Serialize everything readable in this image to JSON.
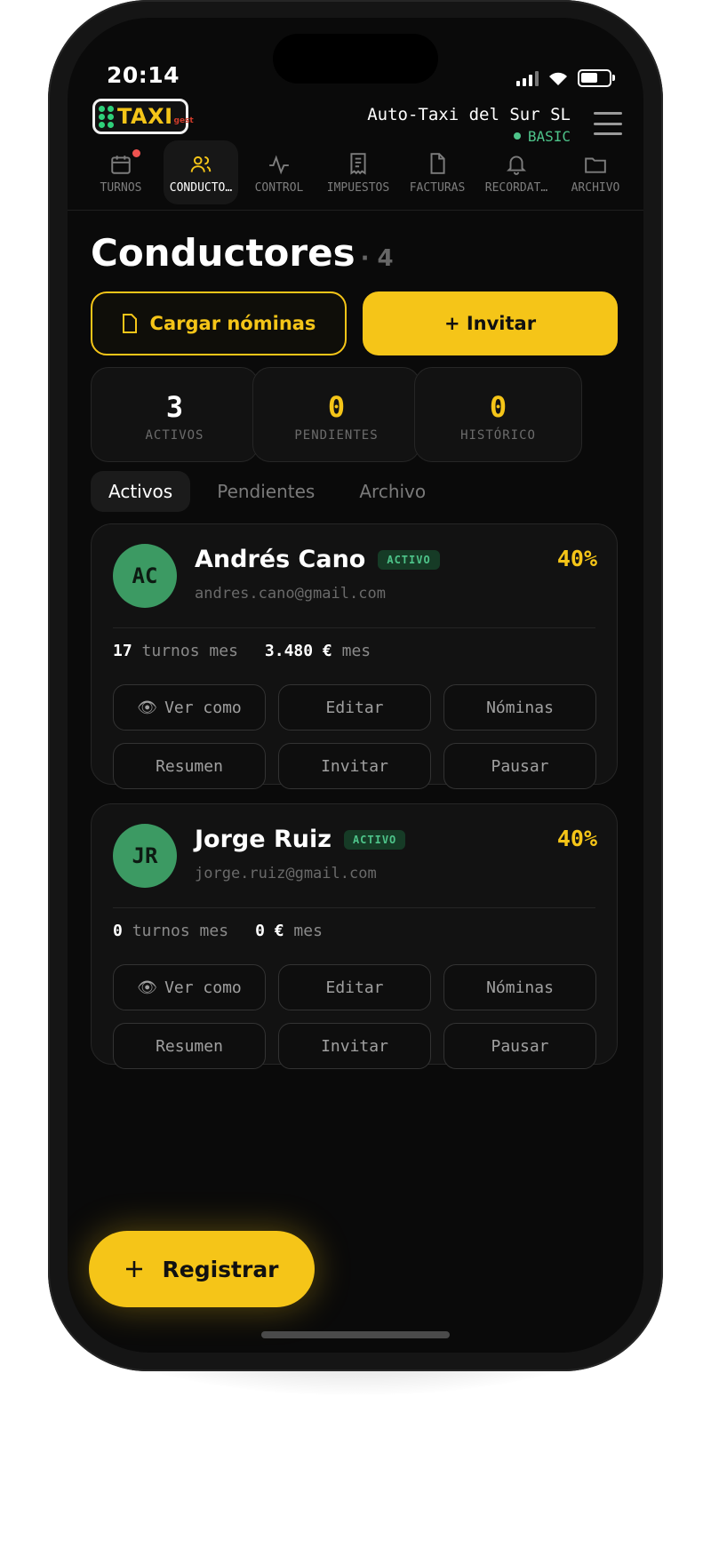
{
  "status_bar": {
    "time": "20:14"
  },
  "logo": {
    "text": "TAXI",
    "sub": "gest"
  },
  "company": {
    "name": "Auto-Taxi del Sur SL",
    "plan": "BASIC"
  },
  "nav": [
    {
      "label": "TURNOS",
      "icon": "calendar-icon"
    },
    {
      "label": "CONDUCTO…",
      "icon": "users-icon"
    },
    {
      "label": "CONTROL",
      "icon": "activity-icon"
    },
    {
      "label": "IMPUESTOS",
      "icon": "receipt-icon"
    },
    {
      "label": "FACTURAS",
      "icon": "file-icon"
    },
    {
      "label": "RECORDAT…",
      "icon": "bell-icon"
    },
    {
      "label": "ARCHIVO",
      "icon": "folder-icon"
    }
  ],
  "page": {
    "title": "Conductores",
    "count": "· 4"
  },
  "actions": {
    "upload_label": "Cargar nóminas",
    "invite_label": "+ Invitar"
  },
  "stats": [
    {
      "value": "3",
      "label": "ACTIVOS",
      "color": "#ffffff"
    },
    {
      "value": "0",
      "label": "PENDIENTES",
      "color": "#f5c518"
    },
    {
      "value": "0",
      "label": "HISTÓRICO",
      "color": "#f5c518"
    }
  ],
  "tabs": [
    "Activos",
    "Pendientes",
    "Archivo"
  ],
  "drivers": [
    {
      "initials": "AC",
      "name": "Andrés Cano",
      "status": "ACTIVO",
      "email": "andres.cano@gmail.com",
      "percent": "40%",
      "shifts": "17",
      "shifts_label": "turnos mes",
      "revenue": "3.480 €",
      "revenue_label": "mes",
      "buttons": [
        "Ver como",
        "Editar",
        "Nóminas",
        "Resumen",
        "Invitar",
        "Pausar"
      ]
    },
    {
      "initials": "JR",
      "name": "Jorge Ruiz",
      "status": "ACTIVO",
      "email": "jorge.ruiz@gmail.com",
      "percent": "40%",
      "shifts": "0",
      "shifts_label": "turnos mes",
      "revenue": "0 €",
      "revenue_label": "mes",
      "buttons": [
        "Ver como",
        "Editar",
        "Nóminas",
        "Resumen",
        "Invitar",
        "Pausar"
      ]
    }
  ],
  "fab": {
    "label": "Registrar"
  },
  "colors": {
    "accent": "#f5c518",
    "success": "#4ec48a",
    "background": "#0a0a0a"
  }
}
